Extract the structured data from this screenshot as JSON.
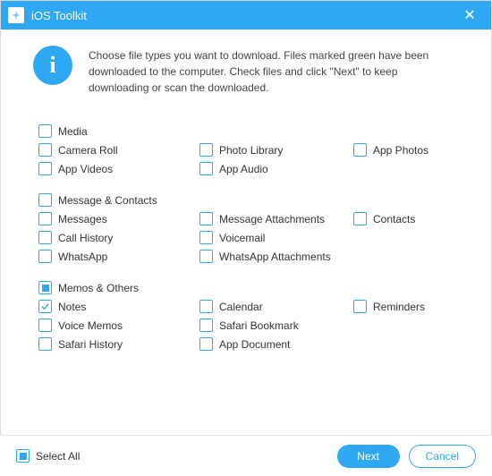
{
  "titlebar": {
    "title": "iOS Toolkit"
  },
  "info": {
    "icon_glyph": "i",
    "text": "Choose file types you want to download. Files marked green have been downloaded to the computer. Check files and click \"Next\" to keep downloading or scan the downloaded."
  },
  "groups": {
    "media": {
      "header": "Media",
      "items": {
        "camera_roll": "Camera Roll",
        "photo_library": "Photo Library",
        "app_photos": "App Photos",
        "app_videos": "App Videos",
        "app_audio": "App Audio"
      }
    },
    "message_contacts": {
      "header": "Message & Contacts",
      "items": {
        "messages": "Messages",
        "message_attachments": "Message Attachments",
        "contacts": "Contacts",
        "call_history": "Call History",
        "voicemail": "Voicemail",
        "whatsapp": "WhatsApp",
        "whatsapp_attachments": "WhatsApp Attachments"
      }
    },
    "memos_others": {
      "header": "Memos & Others",
      "items": {
        "notes": "Notes",
        "calendar": "Calendar",
        "reminders": "Reminders",
        "voice_memos": "Voice Memos",
        "safari_bookmark": "Safari Bookmark",
        "safari_history": "Safari History",
        "app_document": "App Document"
      }
    }
  },
  "footer": {
    "select_all": "Select All",
    "next": "Next",
    "cancel": "Cancel"
  }
}
